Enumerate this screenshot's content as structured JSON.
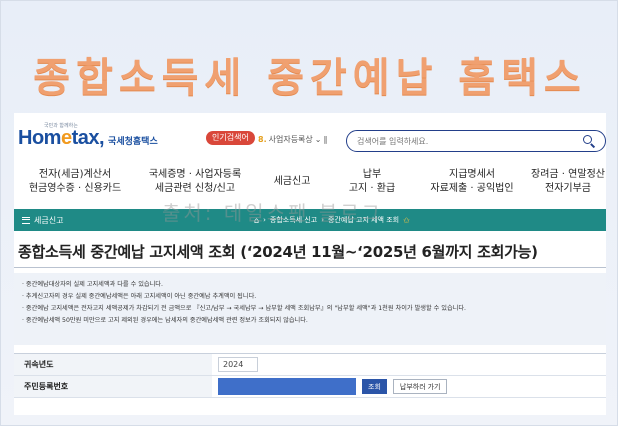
{
  "headline": "종합소득세 중간예납 홈택스",
  "header": {
    "logo_tagline": "국민과 함께하는",
    "logo_text_pre": "Hom",
    "logo_text_e": "e",
    "logo_text_post": "tax,",
    "logo_sub": "국세청홈택스",
    "popular_badge": "인기검색어",
    "biz_select": "사업자등록상",
    "biz_number": "8.",
    "search_placeholder": "검색어를 입력하세요."
  },
  "menu": [
    {
      "line1": "전자(세금)계산서",
      "line2": "현금영수증 · 신용카드"
    },
    {
      "line1": "국세증명 · 사업자등록",
      "line2": "세금관련 신청/신고"
    },
    {
      "line1": "세금신고",
      "line2": ""
    },
    {
      "line1": "납부",
      "line2": "고지 · 환급"
    },
    {
      "line1": "지급명세서",
      "line2": "자료제출 · 공익법인"
    },
    {
      "line1": "장려금 · 연말정산",
      "line2": "전자기부금"
    }
  ],
  "nav": {
    "section": "세금신고",
    "crumb1": "종합소득세 신고",
    "crumb2": "중간예납 고지 세액 조회"
  },
  "watermark": "출처: 데일스팬 블로그",
  "page_title": "종합소득세 중간예납 고지세액 조회 (‘2024년 11월~‘2025년 6월까지 조회가능)",
  "notices": [
    "· 중간예납대상자의 실제 고지세액과 다를 수 있습니다.",
    "· 추계신고자의 경우 실제 중간예납세액은 아래 고지세액이 아닌 중간예납 추계액이 됩니다.",
    "· 중간예납 고지세액은 전자고지 세액공제가 차감되기 전 금액으로 『신고/납부 → 국세납부 → 납부할 세액 조회납부』의 \"납부할 세액\"과 1천원 차이가 발생할 수 있습니다.",
    "· 중간예납세액 50만원 미만으로 고지 제외된 경우에는 납세자의 중간예납세액 관련 정보가 조회되지 않습니다."
  ],
  "form": {
    "year_label": "귀속년도",
    "year_value": "2024",
    "id_label": "주민등록번호",
    "lookup_button": "조회",
    "pay_button": "납부하러 가기"
  },
  "colors": {
    "brand": "#1a4fa0",
    "nav_bar": "#1f8a86",
    "headline": "#f0a070",
    "badge": "#d9473a"
  }
}
